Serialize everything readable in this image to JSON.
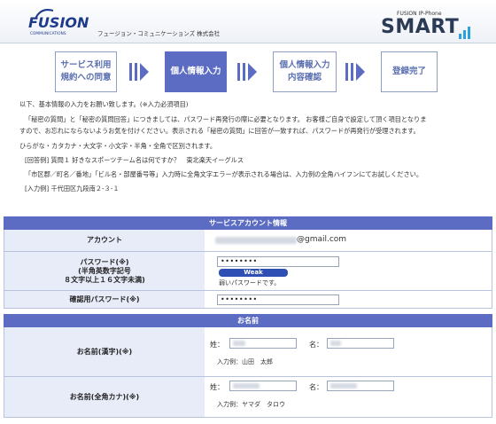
{
  "header": {
    "logo_word": "FUSION",
    "logo_sub": "COMMUNICATIONS",
    "company": "フュージョン・コミュニケーションズ 株式会社",
    "product_small": "FUSION IP-Phone",
    "product_big": "SMART"
  },
  "steps": [
    {
      "line1": "サービス利用",
      "line2": "規約への同意"
    },
    {
      "line1": "個人情報入力",
      "line2": ""
    },
    {
      "line1": "個人情報入力",
      "line2": "内容確認"
    },
    {
      "line1": "登録完了",
      "line2": ""
    }
  ],
  "intro": {
    "line1": "以下、基本情報の入力をお願い致します。(※入力必須項目)",
    "line2": "「秘密の質問」と「秘密の質問回答」につきましては、パスワード再発行の際に必要となります。 お客様ご自身で設定して頂く項目となりま",
    "line3": "すので、お忘れにならないようお気を付けください。表示される「秘密の質問」に回答が一致すれば、パスワードが再発行が受理されます。",
    "line4": "ひらがな・カタカナ・大文字・小文字・半角・全角で区別されます。",
    "line5": "[回答例] 質問１ 好きなスポーツチーム名は何ですか？　東北楽天イーグルス",
    "line6": "「市区郡／町名／番地」「ビル名・部屋番号等」入力時に全角文字エラーが表示される場合は、入力例の全角ハイフンにてお試しください。",
    "line7": "[入力例] 千代田区九段南２-３-１"
  },
  "account_section": {
    "title": "サービスアカウント情報",
    "account_label": "アカウント",
    "account_suffix": "@gmail.com",
    "password_label_1": "パスワード(※)",
    "password_label_2": "(半角英数字記号",
    "password_label_3": "８文字以上１６文字未満)",
    "password_value": "••••••••",
    "strength_badge": "Weak",
    "strength_text": "弱いパスワードです。",
    "confirm_label": "確認用パスワード(※)",
    "confirm_value": "••••••••"
  },
  "name_section": {
    "title": "お名前",
    "kanji_label": "お名前(漢字)(※)",
    "kana_label": "お名前(全角カナ)(※)",
    "sei": "姓：",
    "mei": "名：",
    "kanji_example": "入力例：山田　太郎",
    "kana_example": "入力例：ヤマダ　タロウ"
  },
  "colors": {
    "accent": "#5b6cc2",
    "label_bg": "#e8ecf8",
    "border": "#b9c3de"
  }
}
